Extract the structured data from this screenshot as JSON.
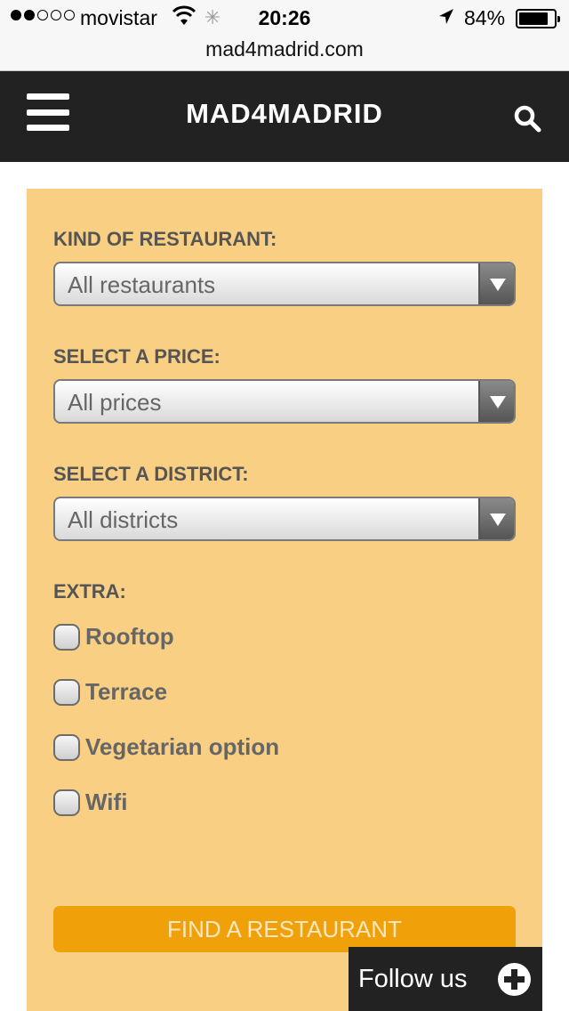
{
  "status_bar": {
    "carrier": "movistar",
    "time": "20:26",
    "battery_percent": "84%",
    "battery_level": 0.84,
    "signal_bars_filled": 2,
    "signal_bars_total": 5
  },
  "browser": {
    "url": "mad4madrid.com"
  },
  "header": {
    "logo": "MAD4MADRID",
    "menu_icon": "hamburger-menu-icon",
    "search_icon": "search-icon",
    "background": "#222222"
  },
  "filters": {
    "kind": {
      "label": "KIND OF RESTAURANT:",
      "value": "All restaurants"
    },
    "price": {
      "label": "SELECT A PRICE:",
      "value": "All prices"
    },
    "district": {
      "label": "SELECT A DISTRICT:",
      "value": "All districts"
    },
    "extra": {
      "label": "EXTRA:",
      "options": [
        {
          "label": "Rooftop",
          "checked": false
        },
        {
          "label": "Terrace",
          "checked": false
        },
        {
          "label": "Vegetarian option",
          "checked": false
        },
        {
          "label": "Wifi",
          "checked": false
        }
      ]
    },
    "submit_label": "FIND A RESTAURANT",
    "panel_color": "#f8cf83",
    "button_color": "#f0a10a"
  },
  "follow": {
    "label": "Follow us",
    "icon": "plus-circle-icon"
  }
}
